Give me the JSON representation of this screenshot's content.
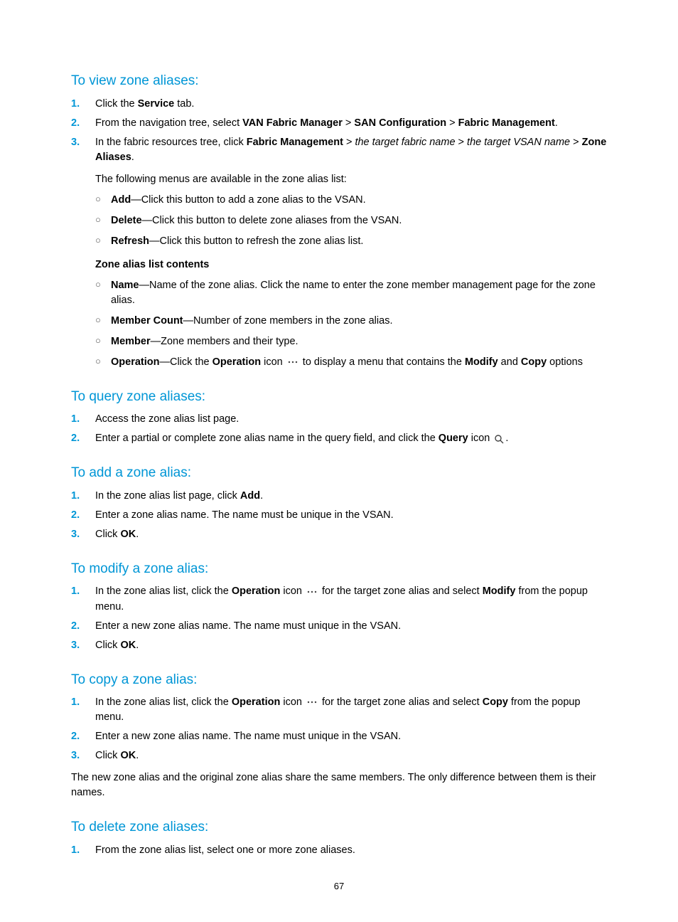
{
  "sections": {
    "view": {
      "heading": "To view zone aliases:",
      "steps": [
        {
          "n": "1.",
          "pre": "Click the ",
          "b1": "Service",
          "post": " tab."
        },
        {
          "n": "2.",
          "pre": "From the navigation tree, select ",
          "b1": "VAN Fabric Manager",
          "sep1": " > ",
          "b2": "SAN Configuration",
          "sep2": " > ",
          "b3": "Fabric Management",
          "post": "."
        },
        {
          "n": "3.",
          "pre": "In the fabric resources tree, click ",
          "b1": "Fabric Management",
          "sep1": " > ",
          "i1": "the target fabric name",
          "sep2": " > ",
          "i2": "the target VSAN name",
          "sep3": " > ",
          "b2": "Zone Aliases",
          "post": "."
        }
      ],
      "followup": "The following menus are available in the zone alias list:",
      "menus": [
        {
          "b": "Add",
          "rest": "—Click this button to add a zone alias to the VSAN."
        },
        {
          "b": "Delete",
          "rest": "—Click this button to delete zone aliases from the VSAN."
        },
        {
          "b": "Refresh",
          "rest": "—Click this button to refresh the zone alias list."
        }
      ],
      "subhead": "Zone alias list contents",
      "contents": [
        {
          "b": "Name",
          "rest": "—Name of the zone alias. Click the name to enter the zone member management page for the zone alias."
        },
        {
          "b": "Member Count",
          "rest": "—Number of zone members in the zone alias."
        },
        {
          "b": "Member",
          "rest": "—Zone members and their type."
        },
        {
          "b": "Operation",
          "rest_a": "—Click the ",
          "b2": "Operation",
          "rest_b": " icon ",
          "rest_c": " to display a menu that contains the ",
          "b3": "Modify",
          "rest_d": " and ",
          "b4": "Copy",
          "rest_e": " options"
        }
      ]
    },
    "query": {
      "heading": "To query zone aliases:",
      "steps": [
        {
          "n": "1.",
          "text": "Access the zone alias list page."
        },
        {
          "n": "2.",
          "pre": "Enter a partial or complete zone alias name in the query field, and click the ",
          "b1": "Query",
          "mid": " icon ",
          "post": "."
        }
      ]
    },
    "add": {
      "heading": "To add a zone alias:",
      "steps": [
        {
          "n": "1.",
          "pre": "In the zone alias list page, click ",
          "b1": "Add",
          "post": "."
        },
        {
          "n": "2.",
          "text": "Enter a zone alias name. The name must be unique in the VSAN."
        },
        {
          "n": "3.",
          "pre": "Click ",
          "b1": "OK",
          "post": "."
        }
      ]
    },
    "modify": {
      "heading": "To modify a zone alias:",
      "steps": [
        {
          "n": "1.",
          "pre": "In the zone alias list, click the ",
          "b1": "Operation",
          "mid": " icon ",
          "post_a": " for the target zone alias and select ",
          "b2": "Modify",
          "post_b": " from the popup menu."
        },
        {
          "n": "2.",
          "text": "Enter a new zone alias name. The name must unique in the VSAN."
        },
        {
          "n": "3.",
          "pre": "Click ",
          "b1": "OK",
          "post": "."
        }
      ]
    },
    "copy": {
      "heading": "To copy a zone alias:",
      "steps": [
        {
          "n": "1.",
          "pre": "In the zone alias list, click the ",
          "b1": "Operation",
          "mid": " icon ",
          "post_a": " for the target zone alias and select ",
          "b2": "Copy",
          "post_b": " from the popup menu."
        },
        {
          "n": "2.",
          "text": "Enter a new zone alias name. The name must unique in the VSAN."
        },
        {
          "n": "3.",
          "pre": "Click ",
          "b1": "OK",
          "post": "."
        }
      ],
      "para": "The new zone alias and the original zone alias share the same members. The only difference between them is their names."
    },
    "delete": {
      "heading": "To delete zone aliases:",
      "steps": [
        {
          "n": "1.",
          "text": "From the zone alias list, select one or more zone aliases."
        }
      ]
    }
  },
  "pagenum": "67"
}
